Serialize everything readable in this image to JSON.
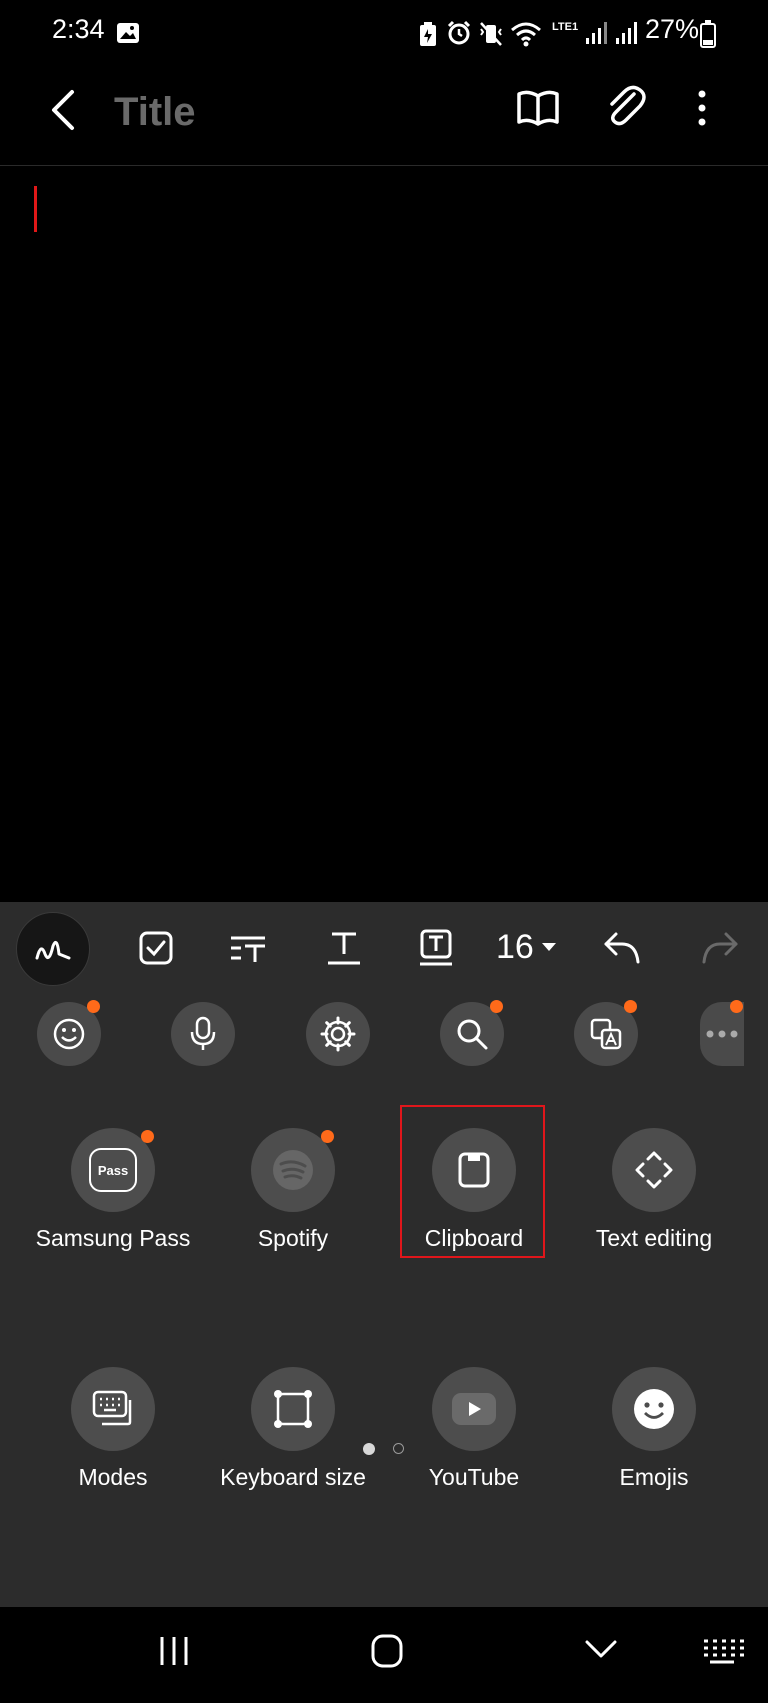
{
  "status_bar": {
    "time": "2:34",
    "battery": "27%",
    "network": "LTE1"
  },
  "app_bar": {
    "title_placeholder": "Title"
  },
  "editor": {
    "content": ""
  },
  "toolbar": {
    "font_size": "16"
  },
  "apps_page1": [
    {
      "label": "Samsung Pass",
      "icon": "samsung-pass-icon",
      "new_badge": true
    },
    {
      "label": "Spotify",
      "icon": "spotify-icon",
      "new_badge": true
    },
    {
      "label": "Clipboard",
      "icon": "clipboard-icon",
      "new_badge": false,
      "highlighted": true
    },
    {
      "label": "Text editing",
      "icon": "text-editing-icon",
      "new_badge": false
    },
    {
      "label": "Modes",
      "icon": "keyboard-modes-icon",
      "new_badge": false
    },
    {
      "label": "Keyboard size",
      "icon": "keyboard-size-icon",
      "new_badge": false
    },
    {
      "label": "YouTube",
      "icon": "youtube-icon",
      "new_badge": false
    },
    {
      "label": "Emojis",
      "icon": "emoji-face-icon",
      "new_badge": false
    }
  ],
  "samsung_pass_icon_text": "Pass",
  "page_indicator": {
    "current": 1,
    "total": 2
  },
  "colors": {
    "accent_badge": "#ff6a1a",
    "highlight": "#e0161b",
    "cursor": "#e01818"
  }
}
